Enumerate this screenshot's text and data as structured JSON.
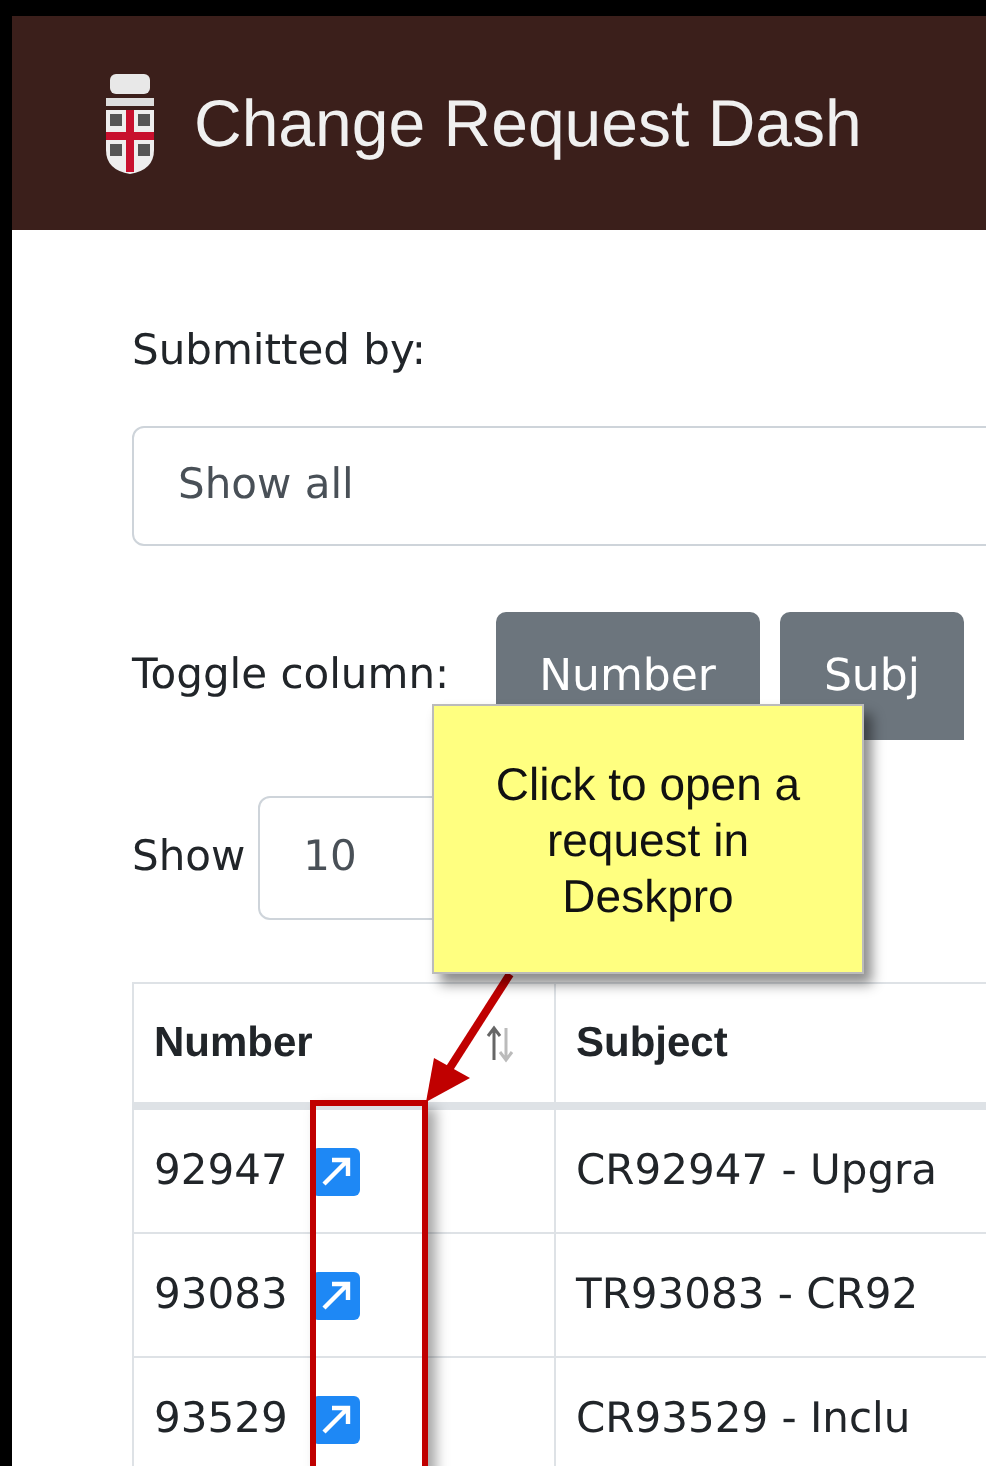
{
  "header": {
    "title": "Change Request Dash"
  },
  "filter": {
    "label": "Submitted by:",
    "value": "Show all"
  },
  "toggle": {
    "label": "Toggle column:",
    "buttons": [
      "Number",
      "Subj"
    ]
  },
  "length": {
    "label": "Show",
    "value": "10"
  },
  "table": {
    "columns": [
      "Number",
      "Subject"
    ],
    "rows": [
      {
        "number": "92947",
        "subject": "CR92947 - Upgra"
      },
      {
        "number": "93083",
        "subject": "TR93083 - CR92"
      },
      {
        "number": "93529",
        "subject": "CR93529 - Inclu"
      }
    ]
  },
  "callout": {
    "text": "Click to open a request in Deskpro"
  }
}
